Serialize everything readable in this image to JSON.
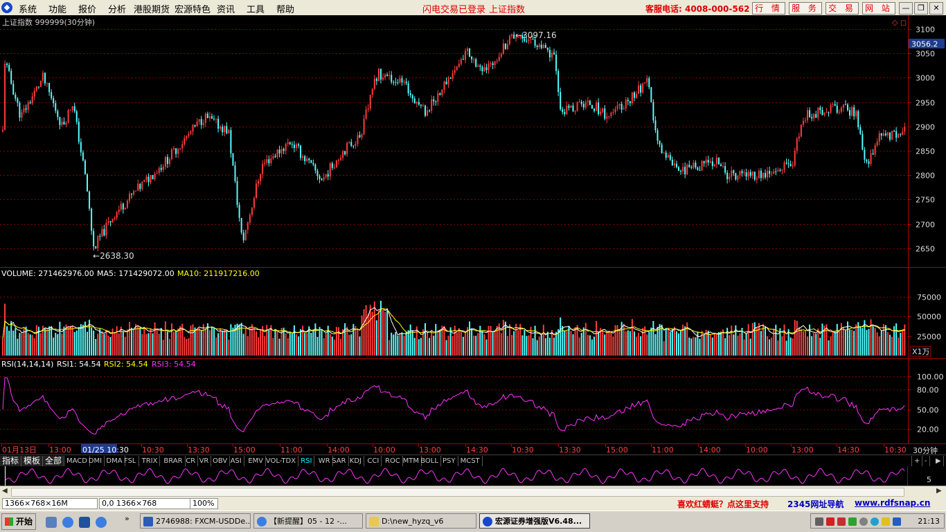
{
  "menubar": {
    "items": [
      "系统",
      "功能",
      "报价",
      "分析",
      "港股期货",
      "宏源特色",
      "资讯",
      "工具",
      "帮助"
    ],
    "status_login": "闪电交易已登录",
    "status_index": "上证指数",
    "hotline": "客服电话: 4008-000-562",
    "buttons": [
      "行 情",
      "服 务",
      "交 易",
      "网 站"
    ],
    "window_controls": [
      "—",
      "❐",
      "✕"
    ]
  },
  "main_chart": {
    "title": "上证指数 999999(30分钟)",
    "y_ticks": [
      "3100",
      "3050",
      "3000",
      "2950",
      "2900",
      "2850",
      "2800",
      "2750",
      "2700",
      "2650"
    ],
    "current_price": "3056.2",
    "high_label": "3097.16",
    "low_label": "2638.30"
  },
  "volume_panel": {
    "volume_label": "VOLUME: 271462976.00",
    "ma5_label": "MA5: 171429072.00",
    "ma10_label": "MA10: 211917216.00",
    "y_ticks": [
      "75000",
      "50000",
      "25000"
    ],
    "unit": "X1万"
  },
  "rsi_panel": {
    "label": "RSI(14,14,14)",
    "rsi1": "RSI1: 54.54",
    "rsi2": "RSI2: 54.54",
    "rsi3": "RSI3: 54.54",
    "y_ticks": [
      "100.00",
      "80.00",
      "50.00",
      "20.00"
    ]
  },
  "time_axis": {
    "labels": [
      "01月13日",
      "13:00",
      "01/25 10:30",
      "10:30",
      "13:30",
      "15:00",
      "11:00",
      "14:00",
      "10:00",
      "13:00",
      "14:30",
      "10:30",
      "13:30",
      "15:00",
      "11:00",
      "14:00",
      "10:00",
      "13:00",
      "14:30",
      "10:30"
    ],
    "period": "30分钟"
  },
  "indicator_tabs": [
    "指标",
    "模板",
    "全部",
    "MACD",
    "DMI",
    "DMA",
    "FSL",
    "TRIX",
    "BRAR",
    "CR",
    "VR",
    "OBV",
    "ASI",
    "EMV",
    "VOL-TDX",
    "RSI",
    "WR",
    "SAR",
    "KDJ",
    "CCI",
    "ROC",
    "MTM",
    "BOLL",
    "PSY",
    "MCST"
  ],
  "tab_controls": [
    "+",
    "-",
    "▶"
  ],
  "strip_tick": "5",
  "statusbar": {
    "size_box": "1366×768×16M",
    "coord_box": "0,0 1366×768",
    "zoom_box": "100%",
    "promo": "喜欢红蜻蜓？点这里支持",
    "nav_link": "2345网址导航",
    "site_link": "www.rdfsnap.cn"
  },
  "taskbar": {
    "start_label": "开始",
    "tasks": [
      "2746988: FXCM-USDDe...",
      "【新提醒】05 - 12 -...",
      "D:\\new_hyzq_v6",
      "宏源证券增强版V6.48..."
    ],
    "clock": "21:13"
  },
  "colors": {
    "up": "#ff3c3c",
    "down": "#54ffff",
    "ma5": "#ffffff",
    "ma10": "#ffff00",
    "rsi": "#ff33ff",
    "grid": "#800000",
    "axis": "#b00000"
  }
}
